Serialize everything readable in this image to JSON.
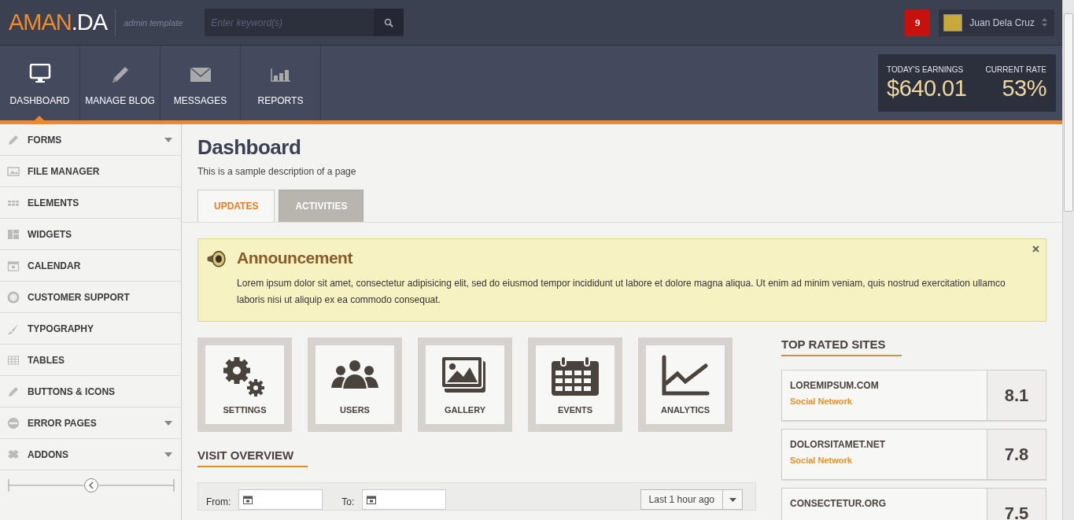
{
  "header": {
    "logo_primary": "AMAN",
    "logo_secondary": ".DA",
    "tagline": "admin template",
    "search": {
      "placeholder": "Enter keyword(s)"
    },
    "notification_count": "9",
    "user_name": "Juan Dela Cruz"
  },
  "nav": [
    {
      "label": "DASHBOARD",
      "selected": true
    },
    {
      "label": "MANAGE BLOG",
      "selected": false
    },
    {
      "label": "MESSAGES",
      "selected": false
    },
    {
      "label": "REPORTS",
      "selected": false
    }
  ],
  "stats": [
    {
      "label": "TODAY'S EARNINGS",
      "value": "$640.01"
    },
    {
      "label": "CURRENT RATE",
      "value": "53%"
    }
  ],
  "sidebar": {
    "items": [
      {
        "label": "FORMS",
        "expandable": true
      },
      {
        "label": "FILE MANAGER",
        "expandable": false
      },
      {
        "label": "ELEMENTS",
        "expandable": false
      },
      {
        "label": "WIDGETS",
        "expandable": false
      },
      {
        "label": "CALENDAR",
        "expandable": false
      },
      {
        "label": "CUSTOMER SUPPORT",
        "expandable": false
      },
      {
        "label": "TYPOGRAPHY",
        "expandable": false
      },
      {
        "label": "TABLES",
        "expandable": false
      },
      {
        "label": "BUTTONS & ICONS",
        "expandable": false
      },
      {
        "label": "ERROR PAGES",
        "expandable": true
      },
      {
        "label": "ADDONS",
        "expandable": true
      }
    ]
  },
  "page": {
    "title": "Dashboard",
    "description": "This is a sample description of a page"
  },
  "tabs": [
    {
      "label": "UPDATES",
      "selected": true
    },
    {
      "label": "ACTIVITIES",
      "selected": false
    }
  ],
  "announcement": {
    "title": "Announcement",
    "text": "Lorem ipsum dolor sit amet, consectetur adipisicing elit, sed do eiusmod tempor incididunt ut labore et dolore magna aliqua. Ut enim ad minim veniam, quis nostrud exercitation ullamco laboris nisi ut aliquip ex ea commodo consequat."
  },
  "shortcuts": [
    {
      "label": "SETTINGS"
    },
    {
      "label": "USERS"
    },
    {
      "label": "GALLERY"
    },
    {
      "label": "EVENTS"
    },
    {
      "label": "ANALYTICS"
    }
  ],
  "visit_overview": {
    "title": "VISIT OVERVIEW",
    "from_label": "From:",
    "to_label": "To:",
    "range": "Last 1 hour ago"
  },
  "top_rated": {
    "title": "TOP RATED SITES",
    "sites": [
      {
        "name": "LOREMIPSUM.COM",
        "category": "Social Network",
        "score": "8.1"
      },
      {
        "name": "DOLORSITAMET.NET",
        "category": "Social Network",
        "score": "7.8"
      },
      {
        "name": "CONSECTETUR.ORG",
        "score": "7.5"
      }
    ]
  }
}
